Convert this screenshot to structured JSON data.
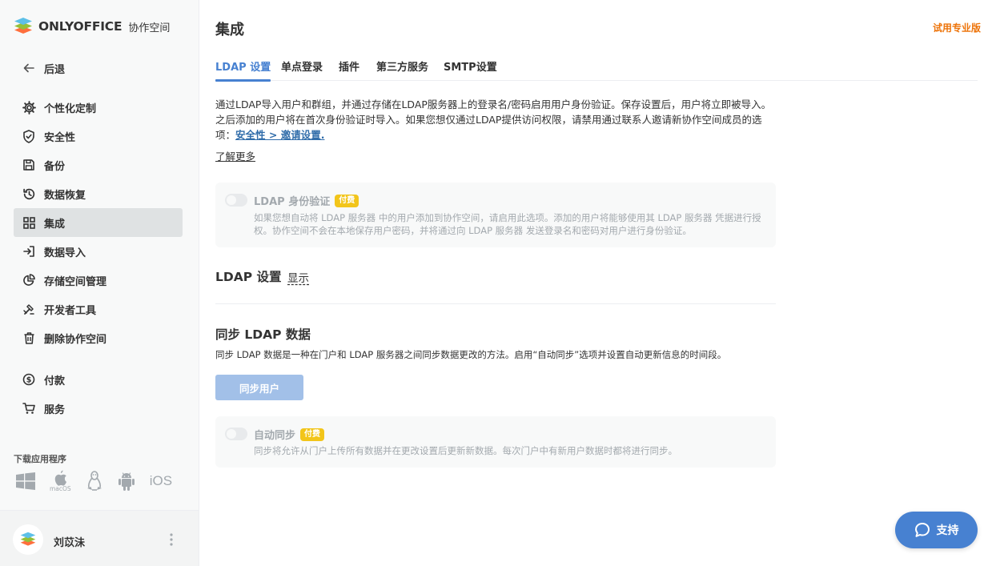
{
  "brand": {
    "name": "ONLYOFFICE",
    "suffix": "协作空间"
  },
  "sidebar": {
    "back_label": "后退",
    "items": [
      {
        "label": "个性化定制",
        "icon": "gear-icon"
      },
      {
        "label": "安全性",
        "icon": "shield-icon"
      },
      {
        "label": "备份",
        "icon": "save-icon"
      },
      {
        "label": "数据恢复",
        "icon": "history-icon"
      },
      {
        "label": "集成",
        "icon": "grid-icon",
        "active": true
      },
      {
        "label": "数据导入",
        "icon": "import-icon"
      },
      {
        "label": "存储空间管理",
        "icon": "pie-icon"
      },
      {
        "label": "开发者工具",
        "icon": "tools-icon"
      },
      {
        "label": "删除协作空间",
        "icon": "trash-icon"
      },
      {
        "label": "付款",
        "icon": "dollar-icon"
      },
      {
        "label": "服务",
        "icon": "cart-icon"
      }
    ],
    "downloads_label": "下载应用程序",
    "apps": {
      "macos_label": "macOS",
      "ios_label": "iOS"
    }
  },
  "profile": {
    "name": "刘苡沬"
  },
  "header": {
    "title": "集成",
    "upgrade_label": "试用专业版"
  },
  "tabs": [
    "LDAP 设置",
    "单点登录",
    "插件",
    "第三方服务",
    "SMTP设置"
  ],
  "description": {
    "text": "通过LDAP导入用户和群组，并通过存储在LDAP服务器上的登录名/密码启用用户身份验证。保存设置后，用户将立即被导入。之后添加的用户将在首次身份验证时导入。如果您想仅通过LDAP提供访问权限，请禁用通过联系人邀请新协作空间成员的选项：",
    "link": "安全性 > 邀请设置.",
    "learn_more": "了解更多"
  },
  "ldap_auth": {
    "title": "LDAP 身份验证",
    "badge": "付费",
    "text": "如果您想自动将 LDAP 服务器 中的用户添加到协作空间，请启用此选项。添加的用户将能够使用其 LDAP 服务器 凭据进行授权。协作空间不会在本地保存用户密码，并将通过向 LDAP 服务器 发送登录名和密码对用户进行身份验证。"
  },
  "ldap_settings": {
    "title": "LDAP 设置",
    "show_label": "显示"
  },
  "sync": {
    "title": "同步 LDAP 数据",
    "description": "同步 LDAP 数据是一种在门户和 LDAP 服务器之间同步数据更改的方法。启用“自动同步”选项并设置自动更新信息的时间段。",
    "button_label": "同步用户"
  },
  "auto_sync": {
    "title": "自动同步",
    "badge": "付费",
    "text": "同步将允许从门户上传所有数据并在更改设置后更新新数据。每次门户中有新用户数据时都将进行同步。"
  },
  "support": {
    "label": "支持"
  },
  "colors": {
    "accent": "#4781d1",
    "upgrade": "#ed7309",
    "badge": "#f2c51a",
    "disabled_button": "#a2c0e8"
  }
}
